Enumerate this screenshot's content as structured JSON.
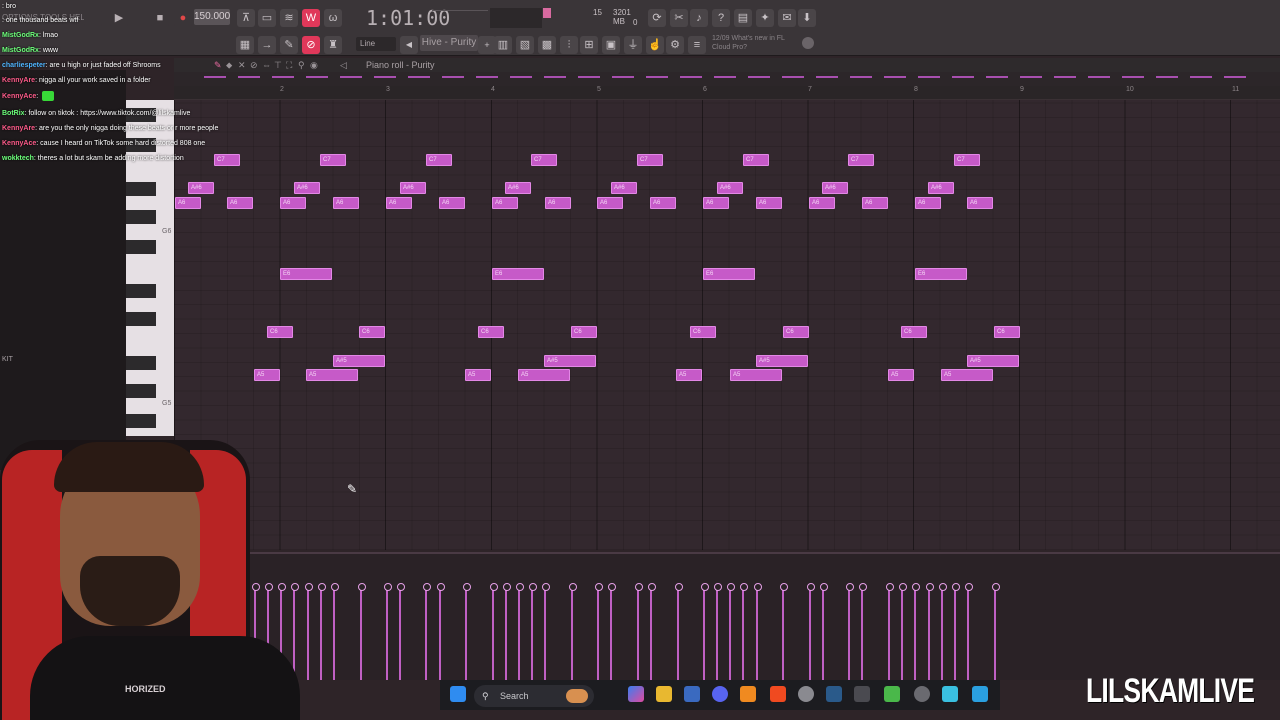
{
  "toolbar": {
    "menu_text": "OPTIONS TOOLS HELP",
    "tempo": "150.000",
    "time": "1:01:00",
    "cpu_text": "3201 MB",
    "cpu_num": "15",
    "cpu_zero": "0",
    "line_mode": "Line",
    "pattern": "Hive - Purity",
    "whats_new_date": "12/09",
    "whats_new_text": "What's new in FL Cloud Pro?"
  },
  "piano_roll": {
    "title": "Piano roll - Purity",
    "ruler": [
      "2",
      "3",
      "4",
      "5",
      "6",
      "7",
      "8",
      "9",
      "10",
      "11"
    ],
    "key_labels": [
      "G6",
      "G5"
    ],
    "note_color": "#c65ac8"
  },
  "notes": [
    {
      "label": "C7",
      "row": "c7",
      "bar": 0
    },
    {
      "label": "A#6",
      "row": "as6",
      "bar": 0
    },
    {
      "label": "A6",
      "row": "a6",
      "bar": 0
    }
  ],
  "chat": [
    {
      "user": "",
      "text": ": bro",
      "color": "#ff5b8a"
    },
    {
      "user": "",
      "text": ": one thousand beats wtf",
      "color": "#ff5b8a"
    },
    {
      "user": "MistGodRx",
      "text": ": lmao",
      "color": "#6cff7a"
    },
    {
      "user": "MistGodRx",
      "text": ": www",
      "color": "#6cff7a"
    },
    {
      "user": "charliespeter",
      "text": ": are u high or just faded off Shrooms",
      "color": "#4fb4ff"
    },
    {
      "user": "KennyAre",
      "text": ": nigga all your work saved in a folder",
      "color": "#ff5b8a"
    },
    {
      "user": "KennyAce",
      "text": ":",
      "color": "#ff5b8a"
    },
    {
      "user": "BotRix",
      "text": ": follow on tiktok : https://www.tiktok.com/@lilskamlive",
      "color": "#6cff7a"
    },
    {
      "user": "KennyAre",
      "text": ": are you the only nigga doing these beats or r more people",
      "color": "#ff5b8a"
    },
    {
      "user": "KennyAce",
      "text": ": cause I heard on TikTok some hard distorted 808 one",
      "color": "#ff5b8a"
    },
    {
      "user": "wokktech",
      "text": ": theres a lot but skam be adding more distortion",
      "color": "#6cff7a"
    }
  ],
  "left_panel": {
    "kit_label": "KIT"
  },
  "taskbar": {
    "search_label": "Search"
  },
  "watermark": "LILSKAMLIVE",
  "webcam_shirt_text": "HORIZED"
}
